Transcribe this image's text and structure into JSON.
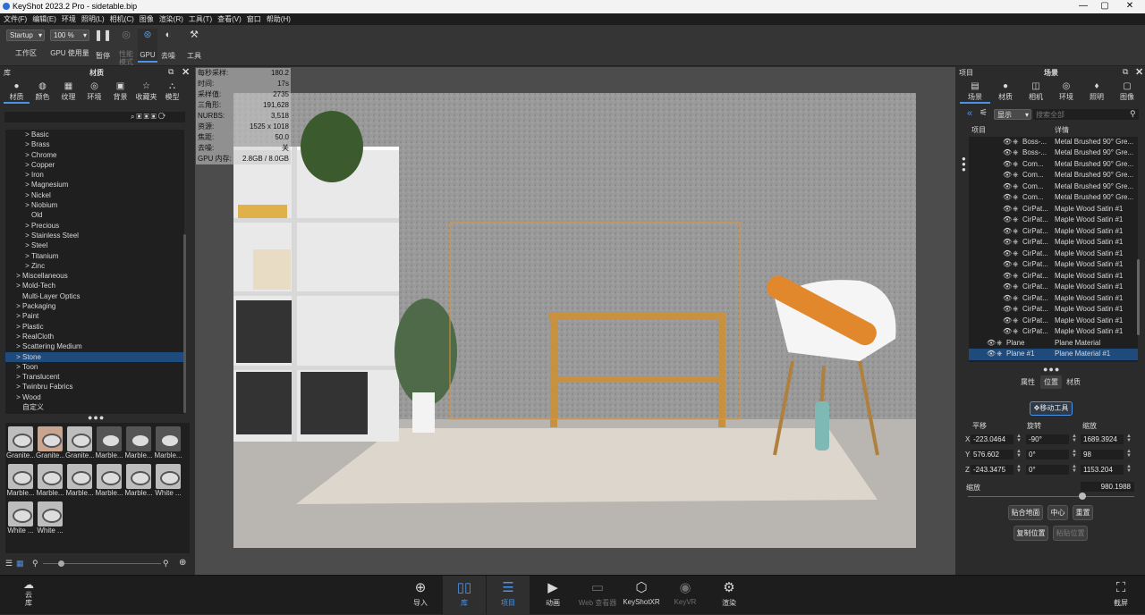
{
  "window": {
    "title": "KeyShot 2023.2 Pro  - sidetable.bip",
    "min": "—",
    "max": "▢",
    "close": "✕"
  },
  "menu": [
    "文件(F)",
    "编辑(E)",
    "环境",
    "照明(L)",
    "相机(C)",
    "图像",
    "渲染(R)",
    "工具(T)",
    "查看(V)",
    "窗口",
    "帮助(H)"
  ],
  "toolbar": {
    "workspace_value": "Startup",
    "workspace_label": "工作区",
    "zoom_value": "100 %",
    "gpu_usage_label": "GPU 使用量",
    "pause_label": "暂停",
    "perf_label": "性能\n模式",
    "gpu_label": "GPU",
    "denoise_label": "去噪",
    "tools_label": "工具"
  },
  "library": {
    "header_left": "库",
    "header_title": "材质",
    "tabs": [
      "材质",
      "颜色",
      "纹理",
      "环境",
      "背景",
      "收藏夹",
      "模型"
    ],
    "tree": [
      {
        "label": "Basic",
        "arrow": ">",
        "indent": 2,
        "sel": false
      },
      {
        "label": "Brass",
        "arrow": ">",
        "indent": 2,
        "sel": false
      },
      {
        "label": "Chrome",
        "arrow": ">",
        "indent": 2,
        "sel": false
      },
      {
        "label": "Copper",
        "arrow": ">",
        "indent": 2,
        "sel": false
      },
      {
        "label": "Iron",
        "arrow": ">",
        "indent": 2,
        "sel": false
      },
      {
        "label": "Magnesium",
        "arrow": ">",
        "indent": 2,
        "sel": false
      },
      {
        "label": "Nickel",
        "arrow": ">",
        "indent": 2,
        "sel": false
      },
      {
        "label": "Niobium",
        "arrow": ">",
        "indent": 2,
        "sel": false
      },
      {
        "label": "Old",
        "arrow": "",
        "indent": 2,
        "sel": false
      },
      {
        "label": "Precious",
        "arrow": ">",
        "indent": 2,
        "sel": false
      },
      {
        "label": "Stainless Steel",
        "arrow": ">",
        "indent": 2,
        "sel": false
      },
      {
        "label": "Steel",
        "arrow": ">",
        "indent": 2,
        "sel": false
      },
      {
        "label": "Titanium",
        "arrow": ">",
        "indent": 2,
        "sel": false
      },
      {
        "label": "Zinc",
        "arrow": ">",
        "indent": 2,
        "sel": false
      },
      {
        "label": "Miscellaneous",
        "arrow": ">",
        "indent": 1,
        "sel": false
      },
      {
        "label": "Mold-Tech",
        "arrow": ">",
        "indent": 1,
        "sel": false
      },
      {
        "label": "Multi-Layer Optics",
        "arrow": "",
        "indent": 1,
        "sel": false
      },
      {
        "label": "Packaging",
        "arrow": ">",
        "indent": 1,
        "sel": false
      },
      {
        "label": "Paint",
        "arrow": ">",
        "indent": 1,
        "sel": false
      },
      {
        "label": "Plastic",
        "arrow": ">",
        "indent": 1,
        "sel": false
      },
      {
        "label": "RealCloth",
        "arrow": ">",
        "indent": 1,
        "sel": false
      },
      {
        "label": "Scattering Medium",
        "arrow": ">",
        "indent": 1,
        "sel": false
      },
      {
        "label": "Stone",
        "arrow": ">",
        "indent": 1,
        "sel": true
      },
      {
        "label": "Toon",
        "arrow": ">",
        "indent": 1,
        "sel": false
      },
      {
        "label": "Translucent",
        "arrow": ">",
        "indent": 1,
        "sel": false
      },
      {
        "label": "Twinbru Fabrics",
        "arrow": ">",
        "indent": 1,
        "sel": false
      },
      {
        "label": "Wood",
        "arrow": ">",
        "indent": 1,
        "sel": false
      },
      {
        "label": "自定义",
        "arrow": "",
        "indent": 1,
        "sel": false
      }
    ],
    "thumbs": [
      "Granite...",
      "Granite...",
      "Granite...",
      "Marble...",
      "Marble...",
      "Marble...",
      "Marble...",
      "Marble...",
      "Marble...",
      "Marble...",
      "Marble...",
      "White ...",
      "White ...",
      "White ..."
    ]
  },
  "stats": [
    [
      "每秒采样:",
      "180.2"
    ],
    [
      "时间:",
      "17s"
    ],
    [
      "采样值:",
      "2735"
    ],
    [
      "三角形:",
      "191,628"
    ],
    [
      "NURBS:",
      "3,518"
    ],
    [
      "资源:",
      "1525 x 1018"
    ],
    [
      "焦距:",
      "50.0"
    ],
    [
      "去噪:",
      "关"
    ],
    [
      "GPU 内存:",
      "2.8GB / 8.0GB"
    ]
  ],
  "project": {
    "header_left": "项目",
    "header_title": "场景",
    "tabs": [
      "场景",
      "材质",
      "相机",
      "环境",
      "照明",
      "图像"
    ],
    "display_value": "显示",
    "search_placeholder": "搜索全部",
    "col_item": "项目",
    "col_detail": "详情",
    "rows": [
      {
        "name": "Boss-...",
        "detail": "Metal Brushed 90° Gre...",
        "indent": 3,
        "sel": false
      },
      {
        "name": "Boss-...",
        "detail": "Metal Brushed 90° Gre...",
        "indent": 3,
        "sel": false
      },
      {
        "name": "Com...",
        "detail": "Metal Brushed 90° Gre...",
        "indent": 3,
        "sel": false
      },
      {
        "name": "Com...",
        "detail": "Metal Brushed 90° Gre...",
        "indent": 3,
        "sel": false
      },
      {
        "name": "Com...",
        "detail": "Metal Brushed 90° Gre...",
        "indent": 3,
        "sel": false
      },
      {
        "name": "Com...",
        "detail": "Metal Brushed 90° Gre...",
        "indent": 3,
        "sel": false
      },
      {
        "name": "CirPat...",
        "detail": "Maple Wood Satin #1",
        "indent": 3,
        "sel": false
      },
      {
        "name": "CirPat...",
        "detail": "Maple Wood Satin #1",
        "indent": 3,
        "sel": false
      },
      {
        "name": "CirPat...",
        "detail": "Maple Wood Satin #1",
        "indent": 3,
        "sel": false
      },
      {
        "name": "CirPat...",
        "detail": "Maple Wood Satin #1",
        "indent": 3,
        "sel": false
      },
      {
        "name": "CirPat...",
        "detail": "Maple Wood Satin #1",
        "indent": 3,
        "sel": false
      },
      {
        "name": "CirPat...",
        "detail": "Maple Wood Satin #1",
        "indent": 3,
        "sel": false
      },
      {
        "name": "CirPat...",
        "detail": "Maple Wood Satin #1",
        "indent": 3,
        "sel": false
      },
      {
        "name": "CirPat...",
        "detail": "Maple Wood Satin #1",
        "indent": 3,
        "sel": false
      },
      {
        "name": "CirPat...",
        "detail": "Maple Wood Satin #1",
        "indent": 3,
        "sel": false
      },
      {
        "name": "CirPat...",
        "detail": "Maple Wood Satin #1",
        "indent": 3,
        "sel": false
      },
      {
        "name": "CirPat...",
        "detail": "Maple Wood Satin #1",
        "indent": 3,
        "sel": false
      },
      {
        "name": "CirPat...",
        "detail": "Maple Wood Satin #1",
        "indent": 3,
        "sel": false
      },
      {
        "name": "Plane",
        "detail": "Plane Material",
        "indent": 1,
        "sel": false
      },
      {
        "name": "Plane #1",
        "detail": "Plane Material #1",
        "indent": 1,
        "sel": true
      }
    ],
    "subtabs": [
      "属性",
      "位置",
      "材质"
    ],
    "move_tool": "移动工具",
    "col_translate": "平移",
    "col_rotate": "旋转",
    "col_scale": "缩放",
    "x": {
      "label": "X",
      "t": "-223.0464",
      "r": "-90°",
      "s": "1689.3924"
    },
    "y": {
      "label": "Y",
      "t": "576.602",
      "r": "0°",
      "s": "98"
    },
    "z": {
      "label": "Z",
      "t": "-243.3475",
      "r": "0°",
      "s": "1153.204"
    },
    "uniform_label": "缩放",
    "uniform_value": "980.1988",
    "uniform_fraction": 0.69,
    "btn_ground": "贴合地面",
    "btn_center": "中心",
    "btn_reset": "重置",
    "btn_copy": "复制位置",
    "btn_paste": "粘贴位置"
  },
  "bottom": {
    "cloud": "云\n库",
    "import": "导入",
    "library": "库",
    "project": "项目",
    "animation": "动画",
    "web": "Web 查看器",
    "keyshotxr": "KeyShotXR",
    "keyvr": "KeyVR",
    "render": "渲染",
    "screenshot": "截屏"
  },
  "colors": {
    "accent": "#4b93e6",
    "selection": "#1e4b7c",
    "selection_box": "#e3962e"
  }
}
